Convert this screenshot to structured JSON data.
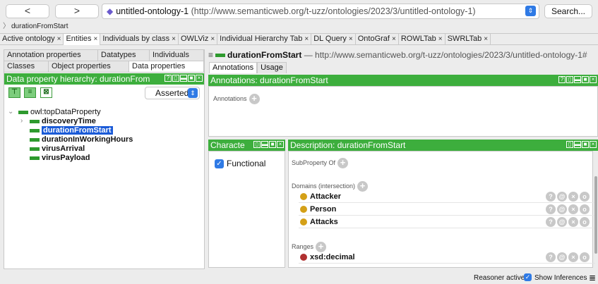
{
  "toolbar": {
    "back_label": "<",
    "forward_label": ">",
    "ontology_name": "untitled-ontology-1",
    "ontology_iri": "(http://www.semanticweb.org/t-uzz/ontologies/2023/3/untitled-ontology-1)",
    "search_label": "Search...",
    "breadcrumb": "durationFromStart"
  },
  "tabs": [
    {
      "label": "Active ontology"
    },
    {
      "label": "Entities"
    },
    {
      "label": "Individuals by class"
    },
    {
      "label": "OWLViz"
    },
    {
      "label": "Individual Hierarchy Tab"
    },
    {
      "label": "DL Query"
    },
    {
      "label": "OntoGraf"
    },
    {
      "label": "ROWLTab"
    },
    {
      "label": "SWRLTab"
    }
  ],
  "left": {
    "subtabs": {
      "annotation_properties": "Annotation properties",
      "datatypes": "Datatypes",
      "individuals": "Individuals",
      "classes": "Classes",
      "object_properties": "Object properties",
      "data_properties": "Data properties"
    },
    "header": "Data property hierarchy: durationFrom",
    "asserted": "Asserted",
    "tree": {
      "root": "owl:topDataProperty",
      "items": [
        "discoveryTime",
        "durationFromStart",
        "durationInWorkingHours",
        "virusArrival",
        "virusPayload"
      ]
    }
  },
  "right": {
    "title_name": "durationFromStart",
    "title_iri": "— http://www.semanticweb.org/t-uzz/ontologies/2023/3/untitled-ontology-1#",
    "tabs": {
      "annotations": "Annotations",
      "usage": "Usage"
    },
    "annotations_header": "Annotations: durationFromStart",
    "annotations_label": "Annotations",
    "characteristics_header": "Characte",
    "functional_label": "Functional",
    "description_header": "Description: durationFromStart",
    "subproperty_label": "SubProperty Of",
    "domains_label": "Domains (intersection)",
    "domains": [
      "Attacker",
      "Person",
      "Attacks"
    ],
    "ranges_label": "Ranges",
    "range": "xsd:decimal"
  },
  "status": {
    "reasoner": "Reasoner active",
    "show_inferences": "Show Inferences"
  },
  "colors": {
    "header_green": "#3dae3d",
    "selection_blue": "#1a5ad7",
    "domain_dot": "#d4a017",
    "range_dot": "#b03030"
  }
}
